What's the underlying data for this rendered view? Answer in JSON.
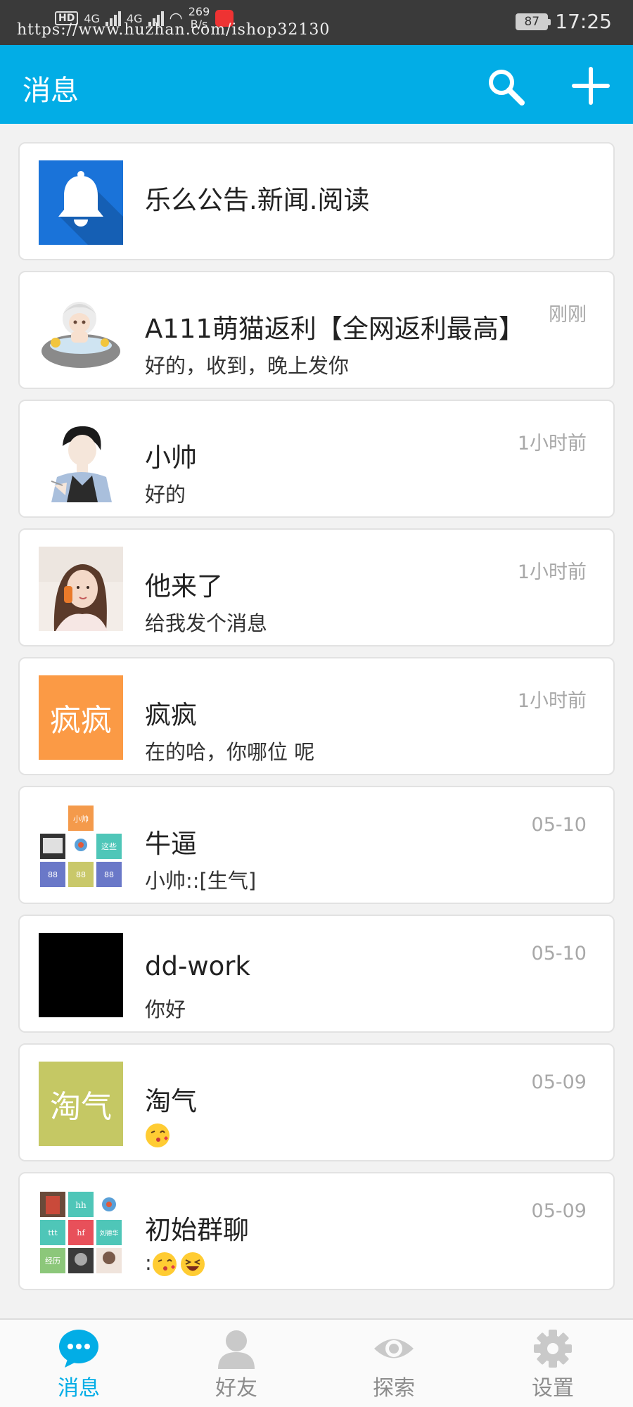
{
  "status_bar": {
    "hd": "HD",
    "net1": "4G",
    "net2": "4G",
    "speed_value": "269",
    "speed_unit": "B/s",
    "url_overlay": "https://www.huzhan.com/ishop32130",
    "battery": "87",
    "time": "17:25"
  },
  "header": {
    "title": "消息",
    "search_icon": "search-icon",
    "add_icon": "plus-icon"
  },
  "conversations": [
    {
      "name": "乐么公告.新闻.阅读",
      "message": "",
      "time": "",
      "avatar": "bell-icon",
      "avatar_color": "#1a73d9"
    },
    {
      "name": "A111萌猫返利【全网返利最高】",
      "message": "好的，收到，晚上发你",
      "time": "刚刚",
      "avatar": "cartoon-avatar"
    },
    {
      "name": "小帅",
      "message": "好的",
      "time": "1小时前",
      "avatar": "cartoon-man-avatar"
    },
    {
      "name": "他来了",
      "message": "给我发个消息",
      "time": "1小时前",
      "avatar": "photo-avatar"
    },
    {
      "name": "疯疯",
      "message": "在的哈，你哪位 呢",
      "time": "1小时前",
      "avatar_text": "疯疯",
      "avatar_color": "#fb9a45"
    },
    {
      "name": "牛逼",
      "message": "小帅::[生气]",
      "time": "05-10",
      "avatar": "group-avatar",
      "group_tiles": [
        "小帅",
        "这些",
        "88",
        "88",
        "88"
      ]
    },
    {
      "name": "dd-work",
      "message": "你好",
      "time": "05-10",
      "avatar_color": "#000000"
    },
    {
      "name": "淘气",
      "message": "",
      "time": "05-09",
      "avatar_text": "淘气",
      "avatar_color": "#c5c864",
      "emojis": [
        "kiss-emoji"
      ]
    },
    {
      "name": "初始群聊",
      "message": ":",
      "time": "05-09",
      "avatar": "group-avatar",
      "group_tiles": [
        "hh",
        "ttt",
        "hf",
        "刘德华",
        "经历"
      ],
      "emojis": [
        "kiss-emoji",
        "laugh-emoji"
      ]
    }
  ],
  "bottom_nav": {
    "active_color": "#02ade6",
    "items": [
      {
        "label": "消息",
        "icon": "chat-bubble-icon",
        "active": true
      },
      {
        "label": "好友",
        "icon": "person-icon",
        "active": false
      },
      {
        "label": "探索",
        "icon": "eye-icon",
        "active": false
      },
      {
        "label": "设置",
        "icon": "gear-icon",
        "active": false
      }
    ]
  },
  "colors": {
    "primary": "#02ade6",
    "background": "#f2f2f2"
  }
}
